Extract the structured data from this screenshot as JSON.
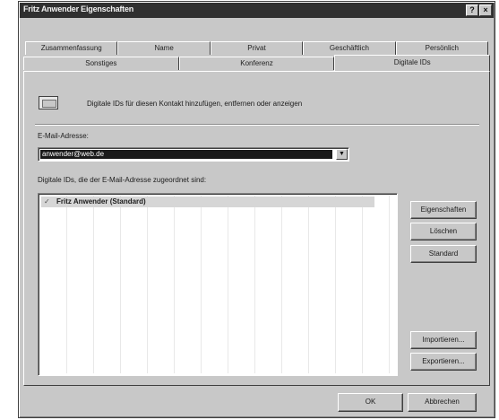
{
  "window": {
    "title": "Fritz Anwender Eigenschaften",
    "help_button": "?",
    "close_button": "×"
  },
  "tabs": {
    "back_row": [
      "Zusammenfassung",
      "Name",
      "Privat",
      "Geschäftlich",
      "Persönlich"
    ],
    "front_row": [
      "Sonstiges",
      "Konferenz",
      "Digitale IDs"
    ],
    "active": "Digitale IDs"
  },
  "panel": {
    "intro_text": "Digitale IDs für diesen Kontakt hinzufügen, entfernen oder anzeigen",
    "email_label": "E-Mail-Adresse:",
    "email_value": "anwender@web.de",
    "select_arrow": "▼",
    "ids_label": "Digitale IDs, die der E-Mail-Adresse zugeordnet sind:",
    "id_items": [
      {
        "check": "✓",
        "label": "Fritz Anwender  (Standard)"
      }
    ],
    "buttons": {
      "properties": "Eigenschaften",
      "delete": "Löschen",
      "default": "Standard",
      "import": "Importieren...",
      "export": "Exportieren..."
    }
  },
  "footer": {
    "ok": "OK",
    "cancel": "Abbrechen"
  }
}
